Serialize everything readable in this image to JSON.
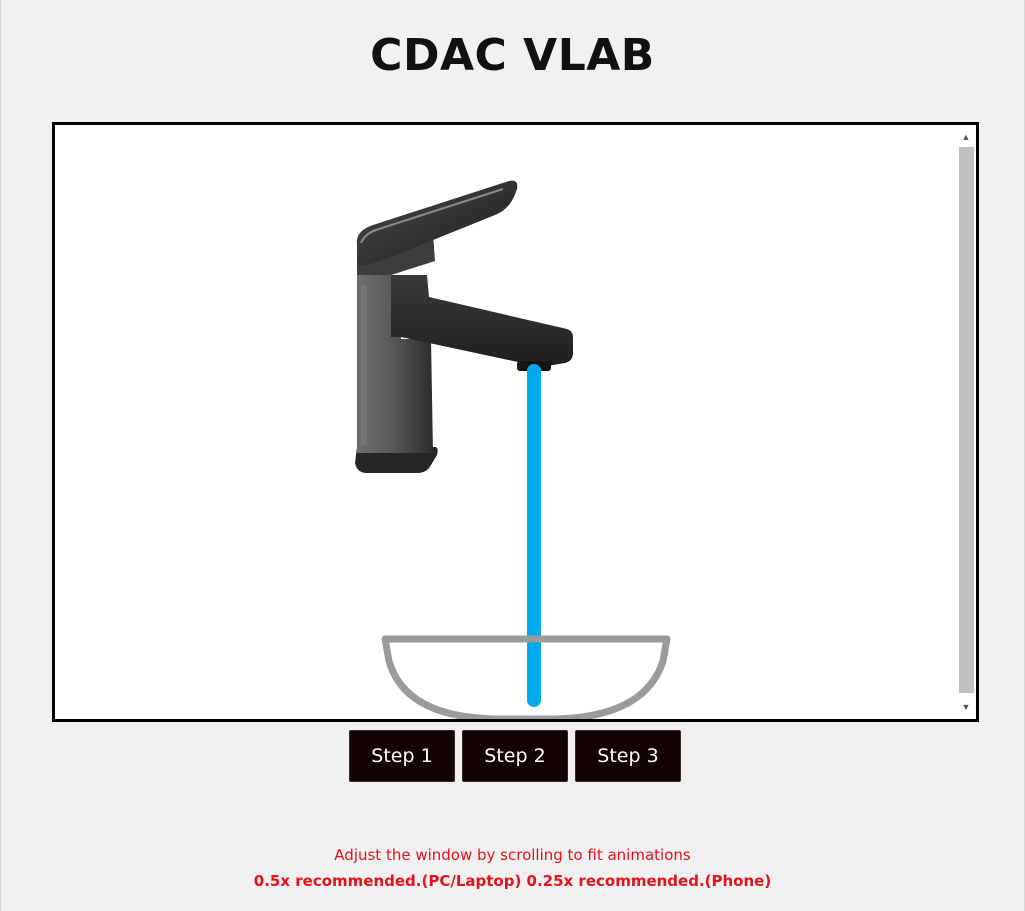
{
  "header": {
    "title": "CDAC VLAB"
  },
  "simulation": {
    "colors": {
      "water": "#00a8ec",
      "basin": "#9b9b9b",
      "faucet": "#2b2b2b"
    },
    "icons": {
      "faucet": "faucet-icon",
      "water_stream": "water-stream-icon",
      "basin": "basin-icon"
    }
  },
  "controls": {
    "steps": [
      {
        "label": "Step 1"
      },
      {
        "label": "Step 2"
      },
      {
        "label": "Step 3"
      }
    ]
  },
  "footer": {
    "note": "Adjust the window by scrolling to fit animations",
    "recommendation": "0.5x recommended.(PC/Laptop) 0.25x recommended.(Phone)",
    "color": "#e3121b"
  }
}
